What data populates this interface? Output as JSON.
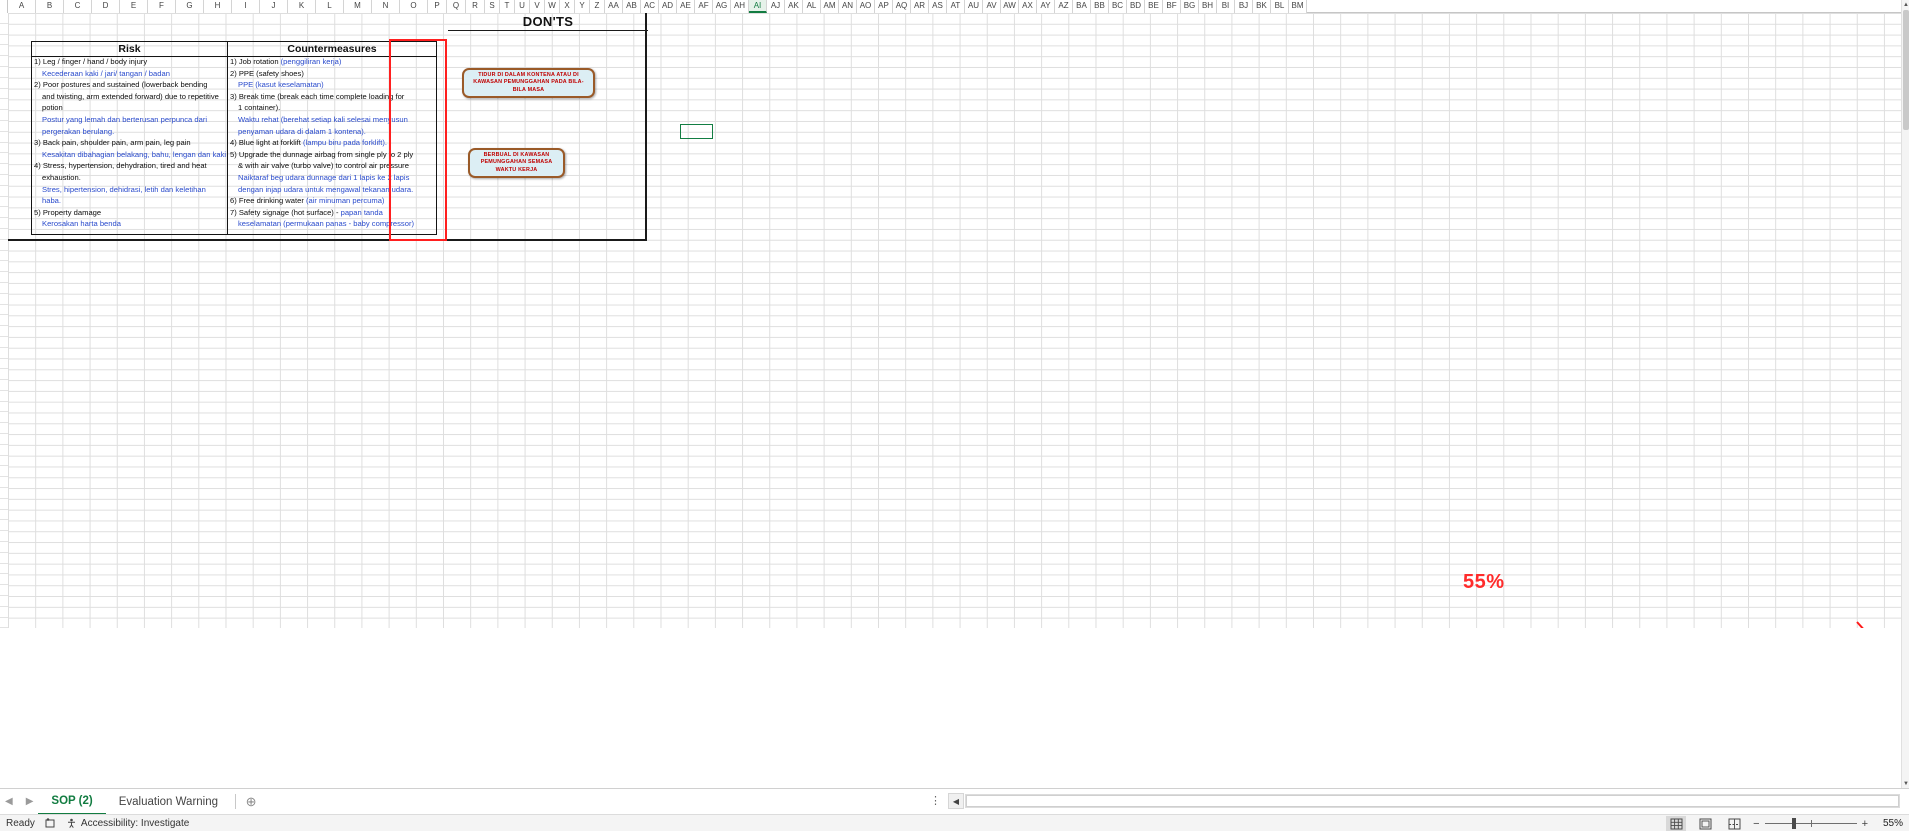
{
  "columns": [
    "A",
    "B",
    "C",
    "D",
    "E",
    "F",
    "G",
    "H",
    "I",
    "J",
    "K",
    "L",
    "M",
    "N",
    "O",
    "P",
    "Q",
    "R",
    "S",
    "T",
    "U",
    "V",
    "W",
    "X",
    "Y",
    "Z",
    "AA",
    "AB",
    "AC",
    "AD",
    "AE",
    "AF",
    "AG",
    "AH",
    "AI",
    "AJ",
    "AK",
    "AL",
    "AM",
    "AN",
    "AO",
    "AP",
    "AQ",
    "AR",
    "AS",
    "AT",
    "AU",
    "AV",
    "AW",
    "AX",
    "AY",
    "AZ",
    "BA",
    "BB",
    "BC",
    "BD",
    "BE",
    "BF",
    "BG",
    "BH",
    "BI",
    "BJ",
    "BK",
    "BL",
    "BM"
  ],
  "selected_column": "AI",
  "document": {
    "donts_title": "DON'TS",
    "table": {
      "header_risk": "Risk",
      "header_countermeasures": "Countermeasures",
      "risk_lines": [
        {
          "text": "1) Leg / finger / hand / body injury",
          "lang": "en",
          "indent": 0
        },
        {
          "text": "Kecederaan kaki / jari/ tangan / badan",
          "lang": "my",
          "indent": 1
        },
        {
          "text": "2) Poor postures and sustained (lowerback bending",
          "lang": "en",
          "indent": 0
        },
        {
          "text": "and twisting, arm extended forward) due to repetitive",
          "lang": "en",
          "indent": 1
        },
        {
          "text": "potion",
          "lang": "en",
          "indent": 1
        },
        {
          "text": "Postur yang lemah dan berterusan perpunca dari",
          "lang": "my",
          "indent": 1
        },
        {
          "text": "pergerakan berulang.",
          "lang": "my",
          "indent": 1
        },
        {
          "text": "3) Back pain, shoulder pain, arm pain, leg pain",
          "lang": "en",
          "indent": 0
        },
        {
          "text": "Kesakitan dibahagian belakang, bahu, lengan dan kaki",
          "lang": "my",
          "indent": 1
        },
        {
          "text": "4) Stress, hypertension, dehydration, tired and heat",
          "lang": "en",
          "indent": 0
        },
        {
          "text": "exhaustion.",
          "lang": "en",
          "indent": 1
        },
        {
          "text": "Stres, hipertension, dehidrasi, letih dan keletihan",
          "lang": "my",
          "indent": 1
        },
        {
          "text": "haba.",
          "lang": "my",
          "indent": 1
        },
        {
          "text": "5) Property damage",
          "lang": "en",
          "indent": 0
        },
        {
          "text": "Kerosakan harta benda",
          "lang": "my",
          "indent": 1
        }
      ],
      "countermeasure_lines": [
        {
          "text": "1) Job rotation ",
          "suffix": "(penggiliran kerja)",
          "lang": "mix",
          "indent": 0
        },
        {
          "text": "2) PPE (safety shoes)",
          "suffix": "",
          "lang": "en",
          "indent": 0
        },
        {
          "text": "",
          "suffix": "PPE (kasut keselamatan)",
          "lang": "my",
          "indent": 1
        },
        {
          "text": "3) Break time (break each time complete loading for",
          "suffix": "",
          "lang": "en",
          "indent": 0
        },
        {
          "text": "1 container).",
          "suffix": "",
          "lang": "en",
          "indent": 1
        },
        {
          "text": "",
          "suffix": "Waktu rehat (berehat setiap kali selesai menyusun",
          "lang": "my",
          "indent": 1
        },
        {
          "text": "",
          "suffix": "penyaman udara di dalam 1 kontena).",
          "lang": "my",
          "indent": 1
        },
        {
          "text": "4) Blue light at forklift ",
          "suffix": "(lampu biru pada forklift).",
          "lang": "mix",
          "indent": 0
        },
        {
          "text": "5) Upgrade the dunnage airbag from single ply to 2 ply",
          "suffix": "",
          "lang": "en",
          "indent": 0
        },
        {
          "text": "& with air valve (turbo valve) to control air pressure",
          "suffix": "",
          "lang": "en",
          "indent": 1
        },
        {
          "text": "",
          "suffix": "Naiktaraf beg udara dunnage dari 1 lapis ke 2 lapis",
          "lang": "my",
          "indent": 1
        },
        {
          "text": "",
          "suffix": "dengan injap udara untuk mengawal tekanan udara.",
          "lang": "my",
          "indent": 1
        },
        {
          "text": "6) Free drinking water ",
          "suffix": "(air minuman percuma)",
          "lang": "mix",
          "indent": 0
        },
        {
          "text": "7) Safety signage (hot surface) - ",
          "suffix": "papan tanda",
          "lang": "mix",
          "indent": 0
        },
        {
          "text": "",
          "suffix": "keselamatan (permukaan panas - baby compressor)",
          "lang": "my",
          "indent": 1
        }
      ]
    },
    "callouts": [
      {
        "id": "callout-1",
        "text": "TIDUR DI DALAM KONTENA ATAU DI KAWASAN PEMUNGGAHAN PADA BILA-BILA MASA"
      },
      {
        "id": "callout-2",
        "text": "BERBUAL DI KAWASAN PEMUNGGAHAN SEMASA WAKTU KERJA"
      }
    ],
    "watermark": "55%"
  },
  "sheet_tabs": {
    "prev_label": "◀",
    "next_label": "▶",
    "tabs": [
      {
        "label": "SOP (2)",
        "active": true
      },
      {
        "label": "Evaluation Warning",
        "active": false
      }
    ],
    "add_label": "⊕",
    "ellipsis": "⋮"
  },
  "status_bar": {
    "ready_label": "Ready",
    "macro_icon": "record-macro-icon",
    "accessibility_label": "Accessibility: Investigate",
    "views": [
      {
        "name": "normal-view",
        "glyph": "⌗",
        "selected": true
      },
      {
        "name": "page-layout-view",
        "glyph": "▤",
        "selected": false
      },
      {
        "name": "page-break-view",
        "glyph": "▥",
        "selected": false
      }
    ],
    "zoom_out": "−",
    "zoom_in": "+",
    "zoom_level": "55%"
  },
  "colors": {
    "accent_green": "#127c41",
    "highlight_red": "#ff1f1f",
    "malay_text_blue": "#2a4bcc",
    "callout_fill": "#dceef4",
    "callout_border": "#9a5a28",
    "callout_text": "#c00000"
  }
}
